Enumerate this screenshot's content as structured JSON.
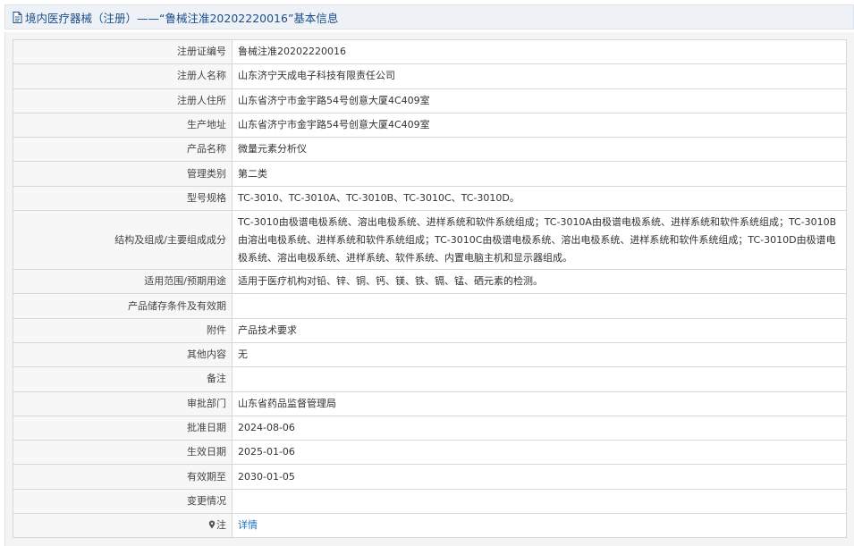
{
  "header": {
    "title": "境内医疗器械（注册）——“鲁械注准20202220016”基本信息",
    "icon": "document-icon"
  },
  "colors": {
    "header_text": "#1a4d8c",
    "link": "#1a6fc4",
    "label_bg": "#f7f7f7",
    "border": "#d7d7d7"
  },
  "rows": [
    {
      "label": "注册证编号",
      "value": "鲁械注准20202220016"
    },
    {
      "label": "注册人名称",
      "value": "山东济宁天成电子科技有限责任公司"
    },
    {
      "label": "注册人住所",
      "value": "山东省济宁市金宇路54号创意大厦4C409室"
    },
    {
      "label": "生产地址",
      "value": "山东省济宁市金宇路54号创意大厦4C409室"
    },
    {
      "label": "产品名称",
      "value": "微量元素分析仪"
    },
    {
      "label": "管理类别",
      "value": "第二类"
    },
    {
      "label": "型号规格",
      "value": "TC-3010、TC-3010A、TC-3010B、TC-3010C、TC-3010D。"
    },
    {
      "label": "结构及组成/主要组成成分",
      "value": "TC-3010由极谱电极系统、溶出电极系统、进样系统和软件系统组成；TC-3010A由极谱电极系统、进样系统和软件系统组成；TC-3010B由溶出电极系统、进样系统和软件系统组成；TC-3010C由极谱电极系统、溶出电极系统、进样系统和软件系统组成；TC-3010D由极谱电极系统、溶出电极系统、进样系统、软件系统、内置电脑主机和显示器组成。"
    },
    {
      "label": "适用范围/预期用途",
      "value": "适用于医疗机构对铅、锌、铜、钙、镁、铁、镉、锰、硒元素的检测。"
    },
    {
      "label": "产品储存条件及有效期",
      "value": ""
    },
    {
      "label": "附件",
      "value": "产品技术要求"
    },
    {
      "label": "其他内容",
      "value": "无"
    },
    {
      "label": "备注",
      "value": ""
    },
    {
      "label": "审批部门",
      "value": "山东省药品监督管理局"
    },
    {
      "label": "批准日期",
      "value": "2024-08-06"
    },
    {
      "label": "生效日期",
      "value": "2025-01-06"
    },
    {
      "label": "有效期至",
      "value": "2030-01-05"
    },
    {
      "label": "变更情况",
      "value": ""
    }
  ],
  "note_row": {
    "label": "注",
    "icon": "pin-icon",
    "link_text": "详情"
  }
}
